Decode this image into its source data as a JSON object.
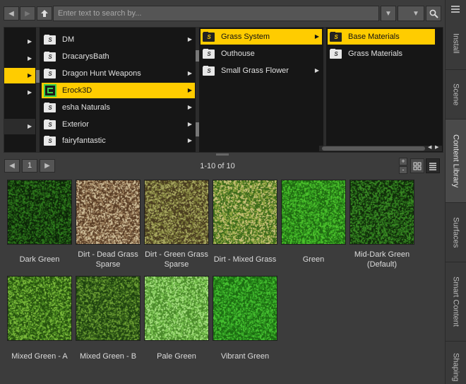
{
  "toolbar": {
    "search_placeholder": "Enter text to search by..."
  },
  "browser": {
    "column1": [
      {
        "label": "DM"
      },
      {
        "label": "DracarysBath"
      },
      {
        "label": "Dragon Hunt Weapons"
      },
      {
        "label": "Erock3D",
        "selected": true
      },
      {
        "label": "esha Naturals"
      },
      {
        "label": "Exterior"
      },
      {
        "label": "fairyfantastic"
      }
    ],
    "column2": [
      {
        "label": "Grass System",
        "selected": true
      },
      {
        "label": "Outhouse"
      },
      {
        "label": "Small Grass Flower"
      }
    ],
    "column3": [
      {
        "label": "Base Materials",
        "selected": true
      },
      {
        "label": "Grass Materials"
      }
    ]
  },
  "pager": {
    "page": "1",
    "range": "1-10 of 10"
  },
  "tiles": [
    {
      "label": "Dark Green",
      "colors": [
        "#0c2608",
        "#1f5512",
        "#2e7a1c"
      ]
    },
    {
      "label": "Dirt - Dead Grass Sparse",
      "colors": [
        "#5a3e26",
        "#9a7d5a",
        "#cdbc98"
      ]
    },
    {
      "label": "Dirt - Green Grass Sparse",
      "colors": [
        "#4a3d20",
        "#7a7a38",
        "#a8a860"
      ]
    },
    {
      "label": "Dirt - Mixed Grass",
      "colors": [
        "#3c6a1a",
        "#8aa23c",
        "#c8c078"
      ]
    },
    {
      "label": "Green",
      "colors": [
        "#1f6a12",
        "#35a020",
        "#4cc22c"
      ]
    },
    {
      "label": "Mid-Dark Green (Default)",
      "colors": [
        "#102c0a",
        "#276a18",
        "#3a8a24"
      ]
    },
    {
      "label": "Mixed Green - A",
      "colors": [
        "#26520f",
        "#4c8a20",
        "#7ab83a"
      ]
    },
    {
      "label": "Mixed Green - B",
      "colors": [
        "#1e4210",
        "#3e6c1c",
        "#6a9c32"
      ]
    },
    {
      "label": "Pale Green",
      "colors": [
        "#4a8a2a",
        "#7ac450",
        "#a6e080"
      ]
    },
    {
      "label": "Vibrant Green",
      "colors": [
        "#1c6c12",
        "#2f9a20",
        "#46c030"
      ]
    }
  ],
  "sidebar": {
    "tabs": [
      "Install",
      "Scene",
      "Content Library",
      "Surfaces",
      "Smart Content",
      "Shaping"
    ]
  },
  "colors": {
    "accent": "#ffcc00",
    "panel": "#3c3c3c",
    "browser_bg": "#161616"
  }
}
